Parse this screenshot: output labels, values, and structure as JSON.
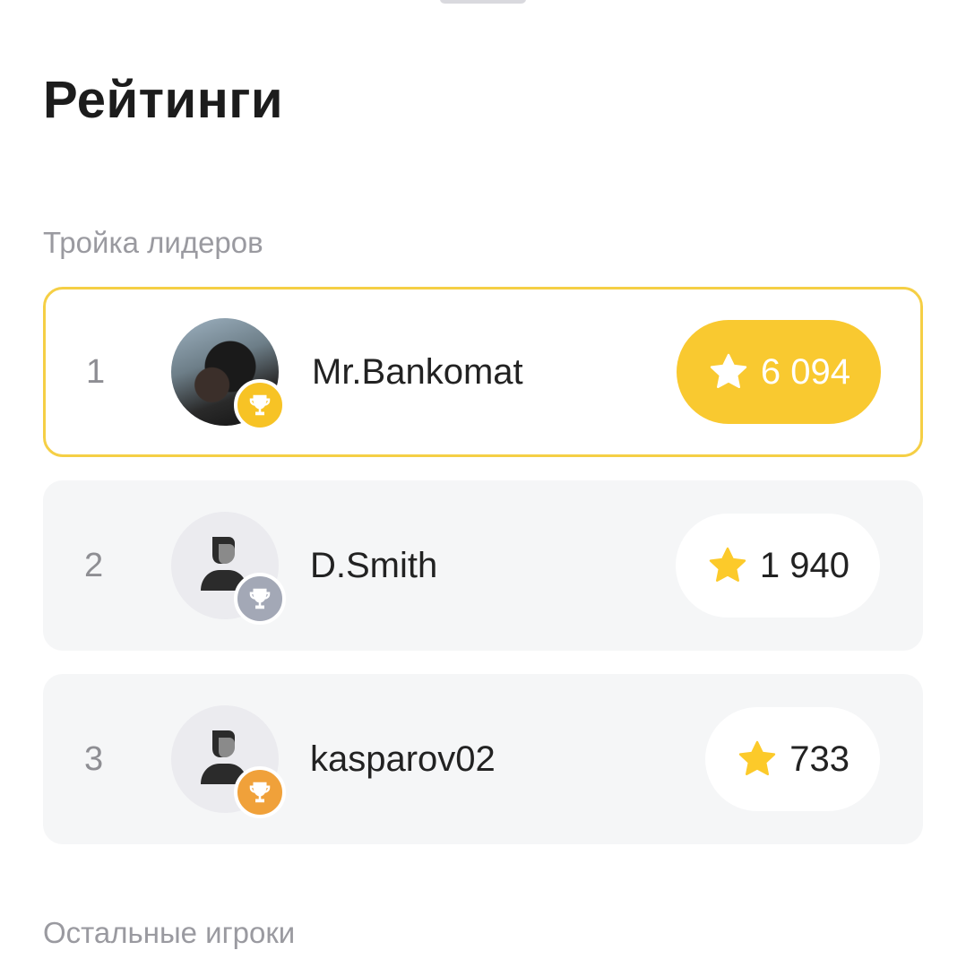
{
  "header": {
    "title": "Рейтинги"
  },
  "sections": {
    "top_three_label": "Тройка лидеров",
    "others_label": "Остальные игроки"
  },
  "players": [
    {
      "rank": "1",
      "name": "Mr.Bankomat",
      "score": "6 094",
      "trophy": "gold-trophy-icon",
      "avatar": "user-photo"
    },
    {
      "rank": "2",
      "name": "D.Smith",
      "score": "1 940",
      "trophy": "silver-trophy-icon",
      "avatar": "default-user-icon"
    },
    {
      "rank": "3",
      "name": "kasparov02",
      "score": "733",
      "trophy": "bronze-trophy-icon",
      "avatar": "default-user-icon"
    }
  ],
  "colors": {
    "gold": "#f9c930",
    "silver": "#a3a8b6",
    "bronze": "#f0a13a",
    "leader_border": "#f5cf45",
    "star": "#fcca2a"
  }
}
